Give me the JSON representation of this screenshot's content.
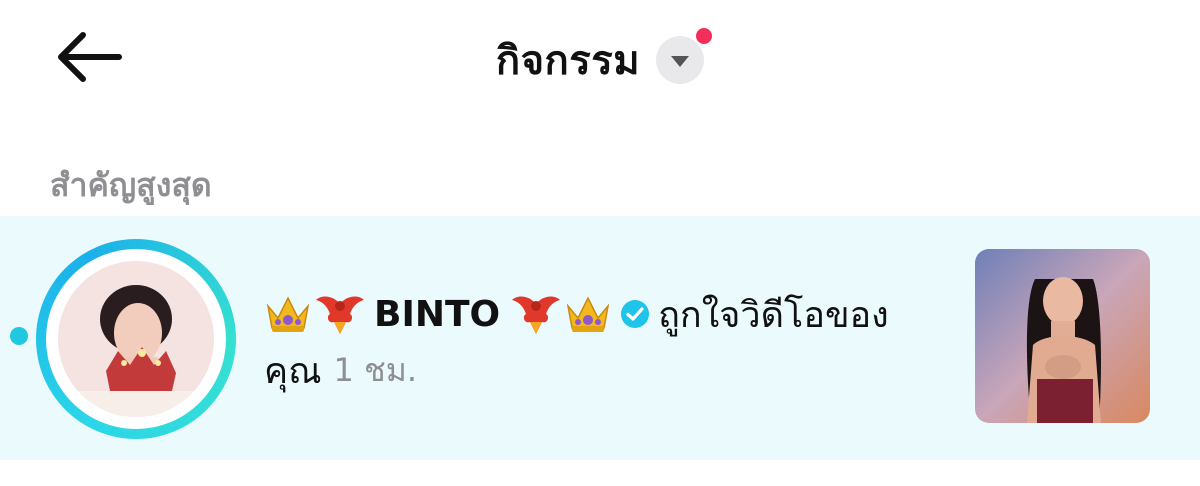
{
  "header": {
    "back_icon": "arrow-left-icon",
    "title": "กิจกรรม",
    "dropdown_icon": "caret-down-icon",
    "notification_dot_color": "#f42e5a"
  },
  "section": {
    "label": "สำคัญสูงสุด"
  },
  "notification": {
    "background": "#ebfafd",
    "ring_color": "#22c8e0",
    "username": "BINTO",
    "emojis_left": [
      "crown-emoji",
      "phoenix-emoji"
    ],
    "emojis_right": [
      "phoenix-emoji",
      "crown-emoji"
    ],
    "verified_icon": "verified-badge-icon",
    "action_line1": "ถูกใจวิดีโอของ",
    "action_line2": "คุณ",
    "time": "1 ชม."
  }
}
